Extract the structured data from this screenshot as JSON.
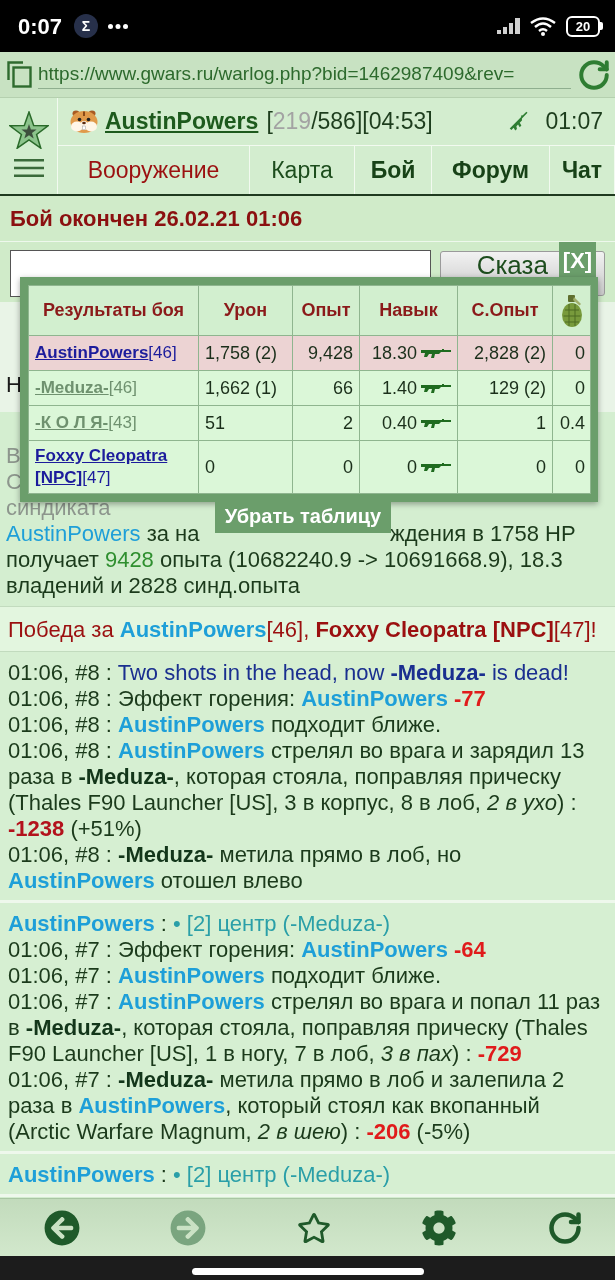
{
  "status_bar": {
    "time": "0:07",
    "notification": "Σ",
    "battery": "20"
  },
  "address_bar": {
    "url": "https://www.gwars.ru/warlog.php?bid=1462987409&rev="
  },
  "header": {
    "player_name": "AustinPowers",
    "stats": [
      {
        "text": "[",
        "kind": "plain"
      },
      {
        "text": "219",
        "kind": "dim"
      },
      {
        "text": "/586][04:53]",
        "kind": "plain"
      }
    ],
    "clock": "01:07",
    "nav": [
      {
        "label": "Вооружение",
        "kind": "alert"
      },
      {
        "label": "Карта",
        "kind": "plain"
      },
      {
        "label": "Бой",
        "kind": "strong"
      },
      {
        "label": "Форум",
        "kind": "strong"
      },
      {
        "label": "Чат",
        "kind": "strong"
      }
    ]
  },
  "battle_title": "Бой окончен 26.02.21 01:06",
  "chat": {
    "button": "Сказа"
  },
  "results_table": {
    "close": "[X]",
    "columns": [
      "Результаты боя",
      "Урон",
      "Опыт",
      "Навык",
      "С.Опыт"
    ],
    "rows": [
      {
        "player": "**AustinPowers**[46]",
        "color": "#1c1c9c",
        "highlighted": true,
        "damage": "1,758 (2)",
        "exp": "9,428",
        "skill": "18.30",
        "s_exp": "2,828 (2)",
        "column_6": "0"
      },
      {
        "player": "**-Meduza-**[46]",
        "color": "#6f916f",
        "highlighted": false,
        "damage": "1,662 (1)",
        "exp": "66",
        "skill": "1.40",
        "s_exp": "129 (2)",
        "column_6": "0"
      },
      {
        "player": "**-К О Л Я-**[43]",
        "color": "#6f916f",
        "highlighted": false,
        "damage": "51",
        "exp": "2",
        "skill": "0.40",
        "s_exp": "1",
        "column_6": "0.4"
      },
      {
        "player": "**Foxxy Cleopatra [NPC]**[47]",
        "color": "#1c1c9c",
        "highlighted": false,
        "damage": "0",
        "exp": "0",
        "skill": "0",
        "s_exp": "0",
        "column_6": "0"
      }
    ],
    "hide_button": "Убрать таблицу"
  },
  "covered": {
    "heading": "Н",
    "lines": [
      "В",
      "С",
      "синдиката"
    ]
  },
  "summary": {
    "fragment_left": [
      {
        "text": "AustinPowers",
        "kind": "name"
      },
      {
        "text": " за на",
        "kind": "text"
      }
    ],
    "fragment_right": [
      {
        "text": "ждения в 1758 HP",
        "kind": "text"
      }
    ],
    "text": [
      {
        "text": "получает ",
        "kind": "text"
      },
      {
        "text": "9428",
        "kind": "gain"
      },
      {
        "text": " опыта (10682240.9 -> 10691668.9), 18.3 владений и 2828 синд.опыта",
        "kind": "text"
      }
    ]
  },
  "victory": [
    {
      "text": "Победа за ",
      "kind": "win"
    },
    {
      "text": "AustinPowers",
      "kind": "name_bold"
    },
    {
      "text": "[46], ",
      "kind": "win"
    },
    {
      "text": "Foxxy Cleopatra [NPC]",
      "kind": "win_bold"
    },
    {
      "text": "[47]!",
      "kind": "win"
    }
  ],
  "log_blocks": [
    {
      "entries": [
        {
          "segments": [
            {
              "text": "01:06, #8 : ",
              "kind": "text"
            },
            {
              "text": "Two shots in the head, now ",
              "kind": "notice"
            },
            {
              "text": "-Meduza-",
              "kind": "notice_bold"
            },
            {
              "text": " is dead!",
              "kind": "notice"
            }
          ]
        },
        {
          "segments": [
            {
              "text": "01:06, #8 : Эффект горения: ",
              "kind": "text"
            },
            {
              "text": "AustinPowers",
              "kind": "name_bold"
            },
            {
              "text": " -77",
              "kind": "damage"
            }
          ]
        },
        {
          "segments": [
            {
              "text": "01:06, #8 : ",
              "kind": "text"
            },
            {
              "text": "AustinPowers",
              "kind": "name_bold"
            },
            {
              "text": " подходит ближе.",
              "kind": "text"
            }
          ]
        },
        {
          "segments": [
            {
              "text": "01:06, #8 : ",
              "kind": "text"
            },
            {
              "text": "AustinPowers",
              "kind": "name_bold"
            },
            {
              "text": " стрелял во врага и зарядил 13 раза в ",
              "kind": "text"
            },
            {
              "text": "-Meduza-",
              "kind": "target"
            },
            {
              "text": ", которая стояла, поправляя прическу (Thales F90 Launcher [US], 3 в корпус, 8 в лоб, ",
              "kind": "text"
            },
            {
              "text": "2 в ухо",
              "kind": "italic"
            },
            {
              "text": ") : ",
              "kind": "text"
            },
            {
              "text": "-1238",
              "kind": "damage_crit"
            },
            {
              "text": " (+51%)",
              "kind": "text"
            }
          ]
        },
        {
          "segments": [
            {
              "text": "01:06, #8 : ",
              "kind": "text"
            },
            {
              "text": "-Meduza-",
              "kind": "target"
            },
            {
              "text": " метила прямо в лоб, но ",
              "kind": "text"
            },
            {
              "text": "AustinPowers",
              "kind": "name_bold"
            },
            {
              "text": " отошел влево",
              "kind": "text"
            }
          ]
        }
      ]
    },
    {
      "entries": [
        {
          "segments": [
            {
              "text": "AustinPowers",
              "kind": "name_bold"
            },
            {
              "text": " : ",
              "kind": "text"
            },
            {
              "text": "• [2] центр (-Meduza-)",
              "kind": "move"
            }
          ]
        },
        {
          "segments": [
            {
              "text": "01:06, #7 : Эффект горения: ",
              "kind": "text"
            },
            {
              "text": "AustinPowers",
              "kind": "name_bold"
            },
            {
              "text": " -64",
              "kind": "damage"
            }
          ]
        },
        {
          "segments": [
            {
              "text": "01:06, #7 : ",
              "kind": "text"
            },
            {
              "text": "AustinPowers",
              "kind": "name_bold"
            },
            {
              "text": " подходит ближе.",
              "kind": "text"
            }
          ]
        },
        {
          "segments": [
            {
              "text": "01:06, #7 : ",
              "kind": "text"
            },
            {
              "text": "AustinPowers",
              "kind": "name_bold"
            },
            {
              "text": " стрелял во врага и попал 11 раз в ",
              "kind": "text"
            },
            {
              "text": "-Meduza-",
              "kind": "target"
            },
            {
              "text": ", которая стояла, поправляя прическу (Thales F90 Launcher [US], 1 в ногу, 7 в лоб, ",
              "kind": "text"
            },
            {
              "text": "3 в пах",
              "kind": "italic"
            },
            {
              "text": ") : ",
              "kind": "text"
            },
            {
              "text": "-729",
              "kind": "damage"
            }
          ]
        },
        {
          "segments": [
            {
              "text": "01:06, #7 : ",
              "kind": "text"
            },
            {
              "text": "-Meduza-",
              "kind": "target"
            },
            {
              "text": " метила прямо в лоб и залепила 2 раза в ",
              "kind": "text"
            },
            {
              "text": "AustinPowers",
              "kind": "name_bold"
            },
            {
              "text": ", который стоял как вкопанный (Arctic Warfare Magnum, ",
              "kind": "text"
            },
            {
              "text": "2 в шею",
              "kind": "italic"
            },
            {
              "text": ") : ",
              "kind": "text"
            },
            {
              "text": "-206",
              "kind": "damage"
            },
            {
              "text": " (-5%)",
              "kind": "text"
            }
          ]
        }
      ]
    },
    {
      "entries": [
        {
          "segments": [
            {
              "text": "AustinPowers",
              "kind": "name_bold"
            },
            {
              "text": " : ",
              "kind": "text"
            },
            {
              "text": "• [2] центр (-Meduza-)",
              "kind": "move"
            }
          ]
        }
      ]
    }
  ]
}
